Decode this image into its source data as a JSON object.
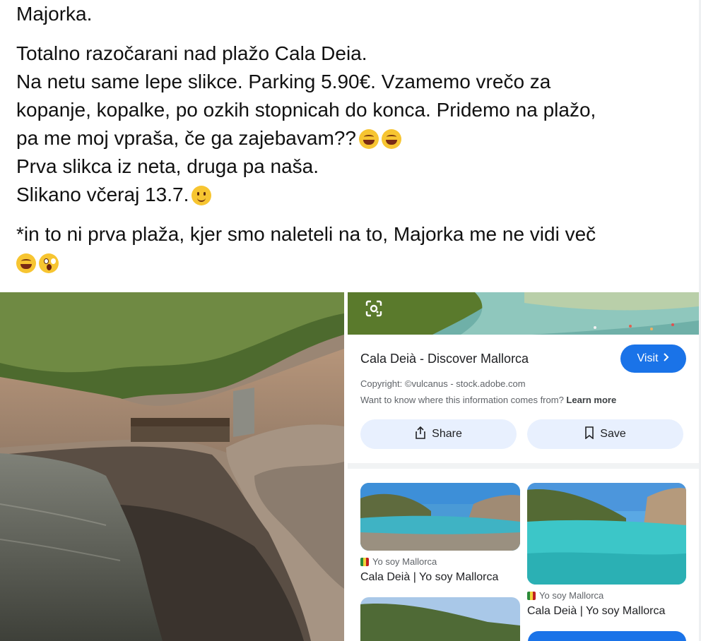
{
  "post": {
    "line_title": "Majorka.",
    "line1": "Totalno razočarani nad plažo Cala Deia.",
    "line2": "Na netu same lepe slikce. Parking 5.90€. Vzamemo vrečo za",
    "line3": "kopanje, kopalke, po ozkih stopnicah do konca. Pridemo na plažo,",
    "line4": "pa me moj vpraša, če ga zajebavam??",
    "line5": "Prva slikca iz neta, druga pa naša.",
    "line6": "Slikano včeraj  13.7.",
    "line7": "*in to ni prva plaža, kjer smo naleteli na to, Majorka me ne vidi več",
    "emoji_names": [
      "rofl-emoji",
      "rofl-emoji",
      "smile-emoji",
      "laughing-emoji",
      "astonished-emoji"
    ]
  },
  "search_result": {
    "title": "Cala Deià - Discover Mallorca",
    "visit_label": "Visit",
    "copyright": "Copyright: ©vulcanus - stock.adobe.com",
    "info_question": "Want to know where this information comes from?",
    "learn_more": "Learn more",
    "share_label": "Share",
    "save_label": "Save",
    "related": [
      {
        "source": "Yo soy Mallorca",
        "title": "Cala Deià | Yo soy Mallorca"
      },
      {
        "source": "Yo soy Mallorca",
        "title": "Cala Deià | Yo soy Mallorca"
      }
    ]
  },
  "colors": {
    "accent_blue": "#1a73e8",
    "chip_bg": "#e8f0fe"
  }
}
